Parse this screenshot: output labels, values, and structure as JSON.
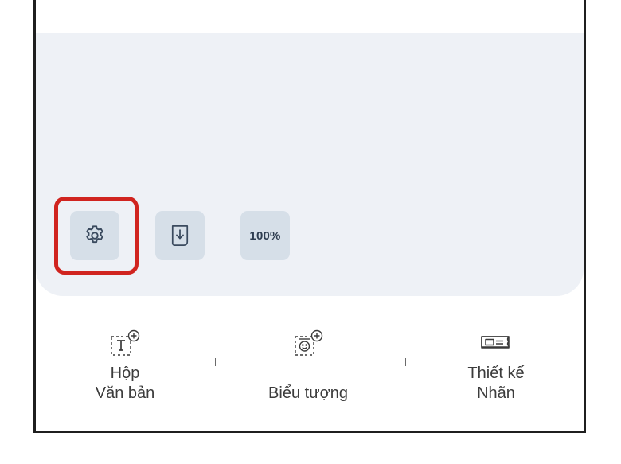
{
  "toolbar": {
    "settings_icon": "gear-icon",
    "export_icon": "download-file-icon",
    "zoom_label": "100%"
  },
  "bottom_bar": {
    "items": [
      {
        "icon": "add-text-box-icon",
        "line1": "Hộp",
        "line2": "Văn bản"
      },
      {
        "icon": "add-emoji-icon",
        "line1": "Biểu tượng",
        "line2": ""
      },
      {
        "icon": "label-design-icon",
        "line1": "Thiết kế",
        "line2": "Nhãn"
      }
    ]
  },
  "colors": {
    "canvas_bg": "#eef1f6",
    "button_bg": "#d6dfe8",
    "highlight": "#d0241f",
    "frame": "#1f1f1f"
  }
}
